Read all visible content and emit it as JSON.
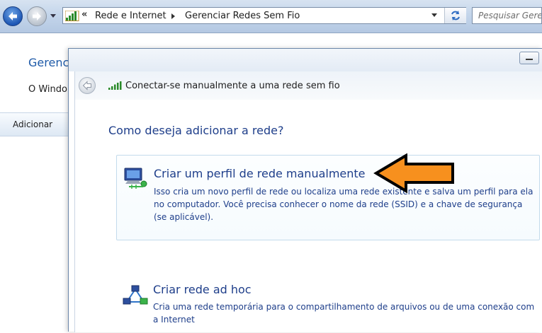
{
  "explorer": {
    "breadcrumbs": [
      "Rede e Internet",
      "Gerenciar Redes Sem Fio"
    ],
    "search_placeholder": "Pesquisar Gerenciar Redes Sem Fio"
  },
  "background": {
    "title": "Gerenc",
    "description": "O Windo",
    "toolbar_button": "Adicionar"
  },
  "wizard": {
    "title": "Conectar-se manualmente a uma rede sem fio",
    "question": "Como deseja adicionar a rede?",
    "options": [
      {
        "title": "Criar um perfil de rede manualmente",
        "description": "Isso cria um novo perfil de rede ou localiza uma rede existente e salva um perfil para ela no computador. Você precisa conhecer o nome da rede (SSID) e a chave de segurança (se aplicável).",
        "icon": "network-profile-icon",
        "selected": true
      },
      {
        "title": "Criar rede ad hoc",
        "description": "Cria uma rede temporária para o compartilhamento de arquivos ou de uma conexão com a Internet",
        "icon": "ad-hoc-network-icon",
        "selected": false
      }
    ]
  },
  "colors": {
    "link_blue": "#1e3e8a",
    "title_blue": "#1e5aa8",
    "arrow_orange": "#f7901e"
  },
  "icons": [
    "back-arrow-icon",
    "forward-arrow-icon",
    "signal-bars-icon",
    "refresh-icon",
    "minimize-icon",
    "orange-arrow-icon"
  ]
}
